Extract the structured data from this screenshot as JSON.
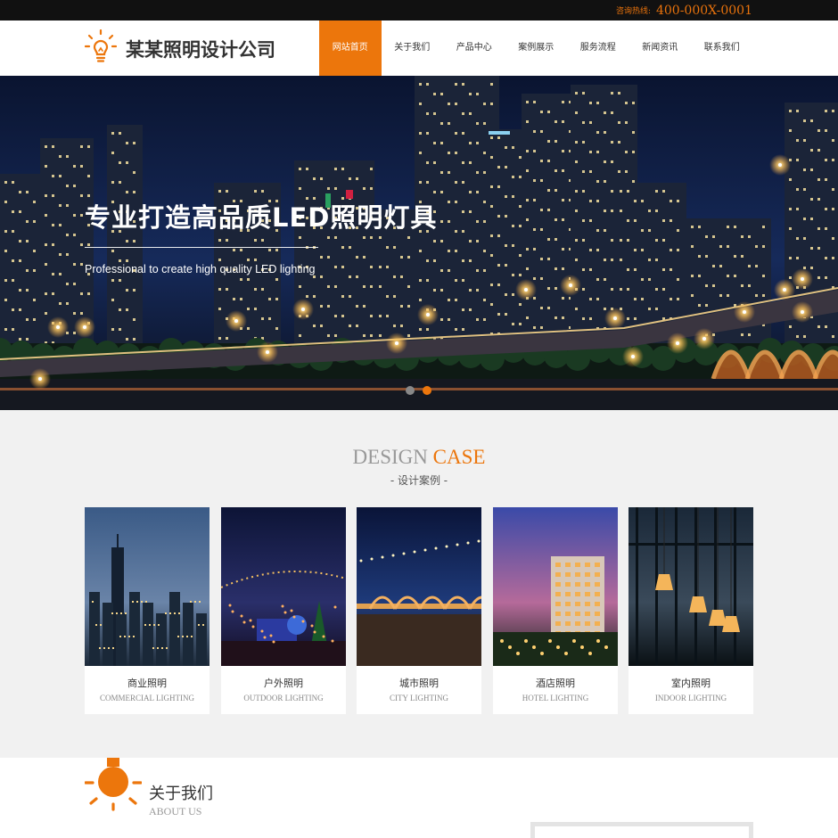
{
  "topbar": {
    "hotline_label": "咨询热线:",
    "hotline_number": "400-000X-0001"
  },
  "header": {
    "logo_icon": "lightbulb-icon",
    "company_name": "某某照明设计公司",
    "nav": [
      {
        "label": "网站首页",
        "active": true
      },
      {
        "label": "关于我们",
        "active": false
      },
      {
        "label": "产品中心",
        "active": false
      },
      {
        "label": "案例展示",
        "active": false
      },
      {
        "label": "服务流程",
        "active": false
      },
      {
        "label": "新闻资讯",
        "active": false
      },
      {
        "label": "联系我们",
        "active": false
      }
    ]
  },
  "banner": {
    "title": "专业打造高品质LED照明灯具",
    "subtitle": "Professional to create high quality LED lighting",
    "slide_count": 2,
    "active_slide": 2
  },
  "design_case": {
    "title_part1": "DESIGN ",
    "title_part2": "CASE",
    "subtitle": "- 设计案例 -",
    "cards": [
      {
        "cn": "商业照明",
        "en": "COMMERCIAL LIGHTING"
      },
      {
        "cn": "户外照明",
        "en": "OUTDOOR LIGHTING"
      },
      {
        "cn": "城市照明",
        "en": "CITY LIGHTING"
      },
      {
        "cn": "酒店照明",
        "en": "HOTEL LIGHTING"
      },
      {
        "cn": "室内照明",
        "en": "INDOOR LIGHTING"
      }
    ]
  },
  "about": {
    "icon": "lightbulb-icon",
    "title_cn": "关于我们",
    "title_en": "ABOUT US"
  },
  "colors": {
    "accent": "#ec760c",
    "topbar": "#111111",
    "section_bg": "#f1f1f1"
  }
}
